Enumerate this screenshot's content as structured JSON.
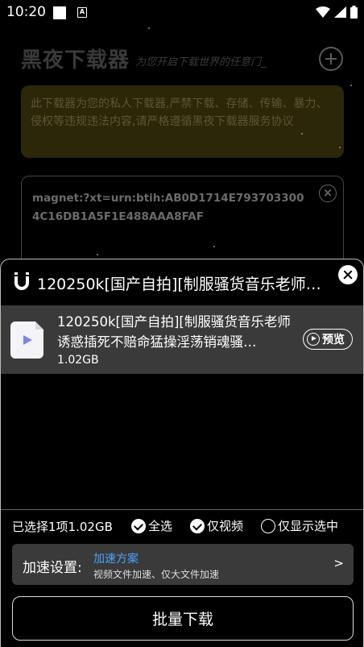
{
  "status_bar": {
    "time": "10:20",
    "icons": [
      "square-icon",
      "a-notification-icon",
      "wifi-icon",
      "signal-icon",
      "battery-icon"
    ]
  },
  "app": {
    "title": "黑夜下载器",
    "subtitle": "为您开启下载世界的任意门_",
    "notice": "此下载器为您的私人下载器,严禁下载、存储、传输、暴力、侵权等违规违法内容,请严格遵循黑夜下载器服务协议",
    "magnet_link": "magnet:?xt=urn:btih:AB0D1714E7937033004C16DB1A5F1E488AAA8FAF"
  },
  "sheet": {
    "title": "120250k[国产自拍][制服骚货音乐老师诱惑插死不赔命猛操淫荡销魂骚…",
    "file": {
      "name": "120250k[国产自拍][制服骚货音乐老师诱惑插死不赔命猛操淫荡销魂骚…",
      "size": "1.02GB",
      "preview_label": "预览"
    },
    "summary": "已选择1项1.02GB",
    "options": {
      "select_all": "全选",
      "video_only": "仅视频",
      "show_selected": "仅显示选中"
    },
    "speed": {
      "label": "加速设置:",
      "plan": "加速方案",
      "desc": "视频文件加速、仅大文件加速",
      "arrow": ">"
    },
    "download_label": "批量下载"
  },
  "colors": {
    "accent_link": "#4aa3ff",
    "notice_bg": "#2c2708",
    "row_bg": "#3a3a3a"
  }
}
